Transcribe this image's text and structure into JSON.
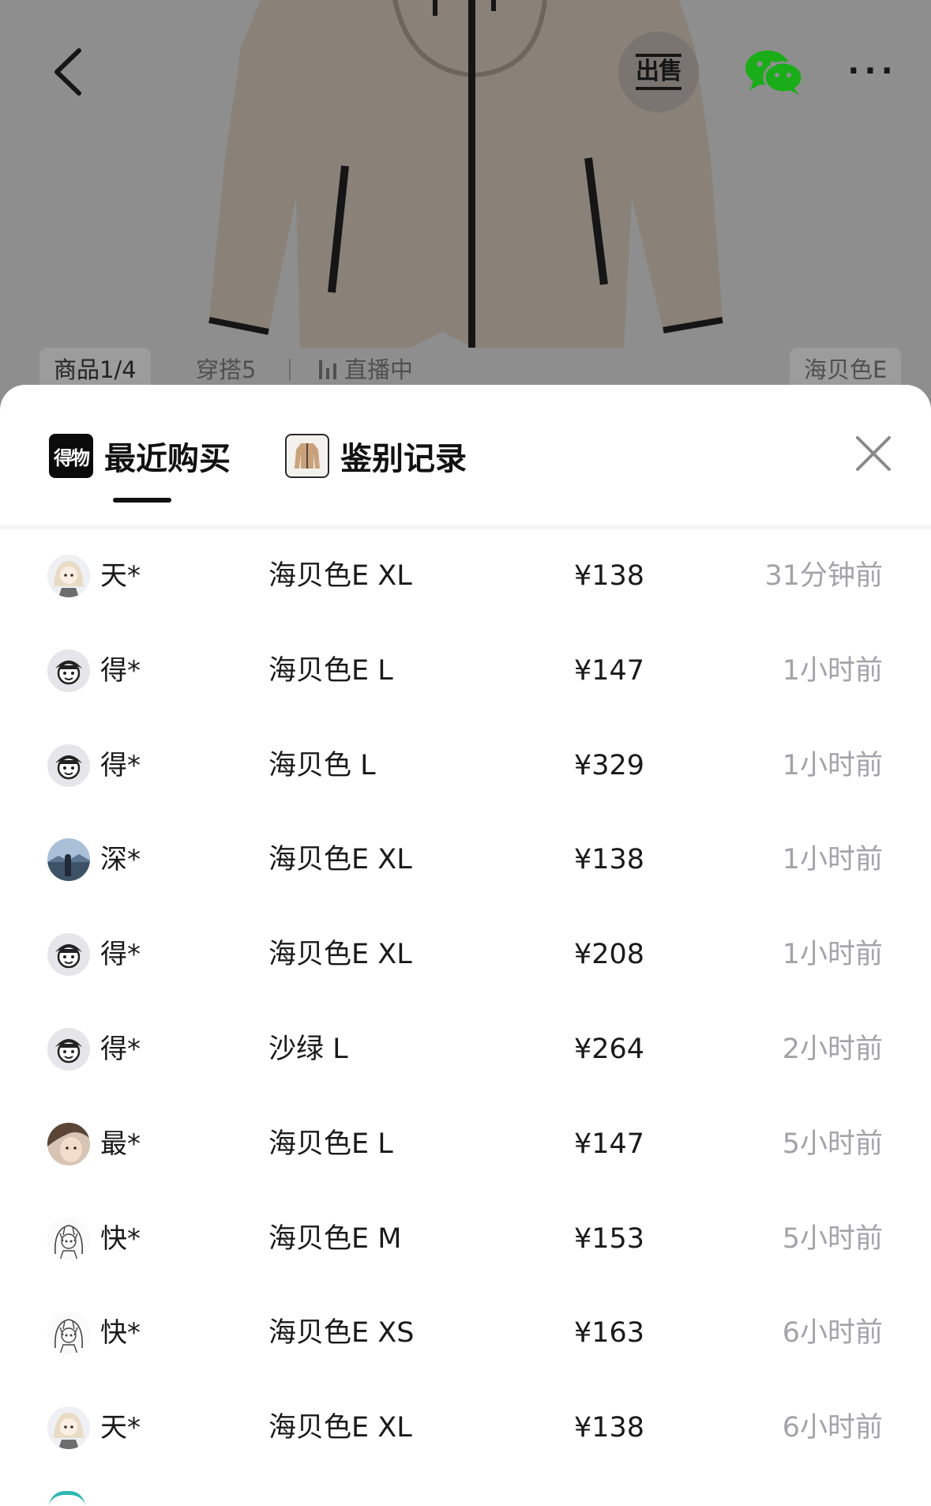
{
  "header": {
    "sell_label": "出售",
    "more_label": "···"
  },
  "sub_tabs": {
    "product": "商品1/4",
    "outfit": "穿搭5",
    "live": "直播中",
    "color": "海贝色E"
  },
  "sheet": {
    "tab_recent": "最近购买",
    "tab_recent_logo": "得物",
    "tab_auth": "鉴别记录"
  },
  "records": [
    {
      "avatar": "anime-girl-avatar",
      "name": "天*",
      "sku": "海贝色E XL",
      "price": "¥138",
      "time": "31分钟前"
    },
    {
      "avatar": "default-cartoon-avatar",
      "name": "得*",
      "sku": "海贝色E L",
      "price": "¥147",
      "time": "1小时前"
    },
    {
      "avatar": "default-cartoon-avatar",
      "name": "得*",
      "sku": "海贝色 L",
      "price": "¥329",
      "time": "1小时前"
    },
    {
      "avatar": "landscape-person-avatar",
      "name": "深*",
      "sku": "海贝色E XL",
      "price": "¥138",
      "time": "1小时前"
    },
    {
      "avatar": "default-cartoon-avatar",
      "name": "得*",
      "sku": "海贝色E XL",
      "price": "¥208",
      "time": "1小时前"
    },
    {
      "avatar": "default-cartoon-avatar",
      "name": "得*",
      "sku": "沙绿 L",
      "price": "¥264",
      "time": "2小时前"
    },
    {
      "avatar": "photo-avatar",
      "name": "最*",
      "sku": "海贝色E L",
      "price": "¥147",
      "time": "5小时前"
    },
    {
      "avatar": "sketch-girl-avatar",
      "name": "快*",
      "sku": "海贝色E M",
      "price": "¥153",
      "time": "5小时前"
    },
    {
      "avatar": "sketch-girl-avatar",
      "name": "快*",
      "sku": "海贝色E XS",
      "price": "¥163",
      "time": "6小时前"
    },
    {
      "avatar": "anime-girl-avatar",
      "name": "天*",
      "sku": "海贝色E XL",
      "price": "¥138",
      "time": "6小时前"
    }
  ],
  "colors": {
    "overlay": "#8e8e8e",
    "jacket": "#8a8178",
    "time_text": "#a3a3a8",
    "wechat_green": "#1aad19"
  }
}
